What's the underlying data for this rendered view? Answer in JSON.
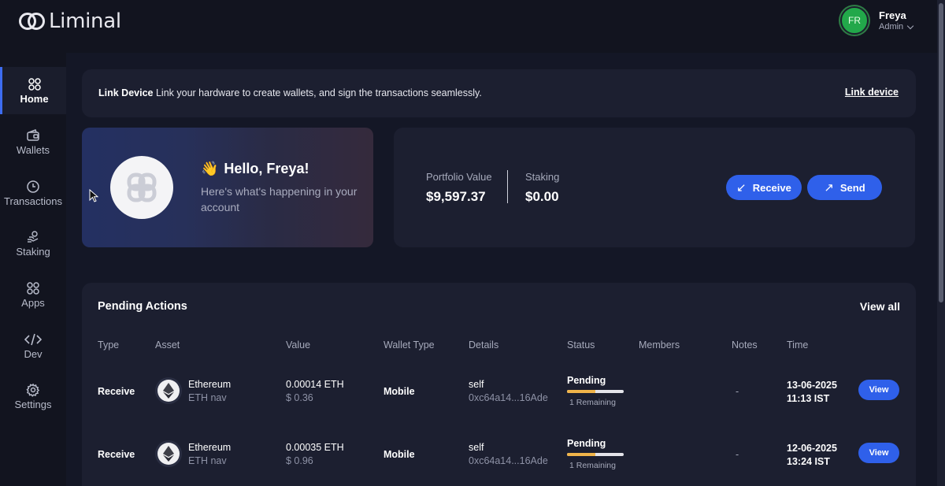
{
  "brand": {
    "name": "Liminal"
  },
  "user": {
    "initials": "FR",
    "name": "Freya",
    "role": "Admin",
    "avatar_color": "#22a84a"
  },
  "sidebar": {
    "items": [
      {
        "label": "Home",
        "icon": "grid-circles-icon",
        "active": true
      },
      {
        "label": "Wallets",
        "icon": "wallet-icon",
        "active": false
      },
      {
        "label": "Transactions",
        "icon": "clock-icon",
        "active": false
      },
      {
        "label": "Staking",
        "icon": "hand-coin-icon",
        "active": false
      },
      {
        "label": "Apps",
        "icon": "apps-circles-icon",
        "active": false
      },
      {
        "label": "Dev",
        "icon": "code-icon",
        "active": false
      },
      {
        "label": "Settings",
        "icon": "gear-icon",
        "active": false
      }
    ]
  },
  "banner": {
    "title": "Link Device",
    "text": "Link your hardware to create wallets, and sign the transactions seamlessly.",
    "link": "Link device"
  },
  "hello": {
    "greeting": "Hello, Freya!",
    "wave": "👋",
    "subtitle": "Here's what's happening in your account"
  },
  "portfolio": {
    "value_label": "Portfolio Value",
    "value": "$9,597.37",
    "staking_label": "Staking",
    "staking_value": "$0.00",
    "receive_label": "Receive",
    "send_label": "Send"
  },
  "pending": {
    "title": "Pending Actions",
    "view_all": "View all",
    "columns": [
      "Type",
      "Asset",
      "Value",
      "Wallet Type",
      "Details",
      "Status",
      "Members",
      "Notes",
      "Time"
    ],
    "rows": [
      {
        "type": "Receive",
        "asset": "Ethereum",
        "asset_sub": "ETH nav",
        "value": "0.00014 ETH",
        "value_usd": "$ 0.36",
        "wallet_type": "Mobile",
        "details": "self",
        "address": "0xc64a14...16Ade",
        "status": "Pending",
        "progress": 0.5,
        "remaining": "1 Remaining",
        "notes": "-",
        "date": "13-06-2025",
        "time": "11:13 IST",
        "action": "View"
      },
      {
        "type": "Receive",
        "asset": "Ethereum",
        "asset_sub": "ETH nav",
        "value": "0.00035 ETH",
        "value_usd": "$ 0.96",
        "wallet_type": "Mobile",
        "details": "self",
        "address": "0xc64a14...16Ade",
        "status": "Pending",
        "progress": 0.5,
        "remaining": "1 Remaining",
        "notes": "-",
        "date": "12-06-2025",
        "time": "13:24 IST",
        "action": "View"
      }
    ]
  },
  "colors": {
    "accent": "#2f60ea",
    "background": "#141726",
    "card": "#1c1f30",
    "progress": "#f0b44a"
  }
}
